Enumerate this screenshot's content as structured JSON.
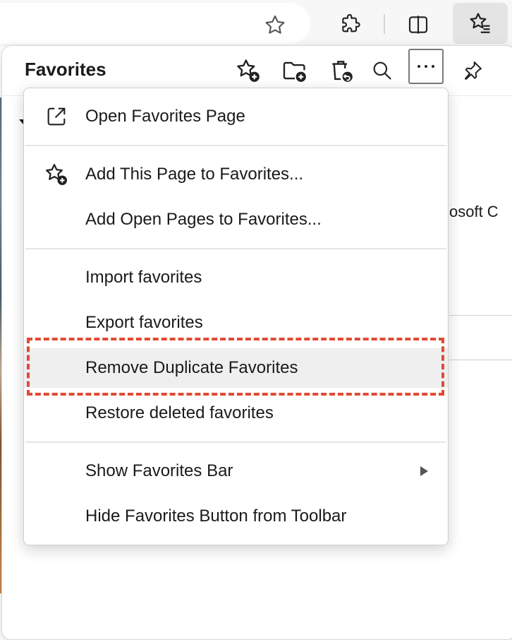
{
  "panel": {
    "title": "Favorites"
  },
  "toolbar_icons": [
    "star-outline-icon",
    "extensions-icon",
    "split-screen-icon",
    "favorites-icon"
  ],
  "panel_icons": [
    "add-favorite-icon",
    "add-folder-icon",
    "deleted-favorites-icon",
    "search-icon",
    "more-icon",
    "pin-icon"
  ],
  "background_text": {
    "fragment": "osoft C"
  },
  "menu": {
    "open_page": "Open Favorites Page",
    "add_page": "Add This Page to Favorites...",
    "add_open_pages": "Add Open Pages to Favorites...",
    "import": "Import favorites",
    "export": "Export favorites",
    "remove_duplicates": "Remove Duplicate Favorites",
    "restore_deleted": "Restore deleted favorites",
    "show_bar": "Show Favorites Bar",
    "hide_button": "Hide Favorites Button from Toolbar"
  },
  "colors": {
    "highlight_box": "#e24a33",
    "hover_background": "#efefef"
  }
}
